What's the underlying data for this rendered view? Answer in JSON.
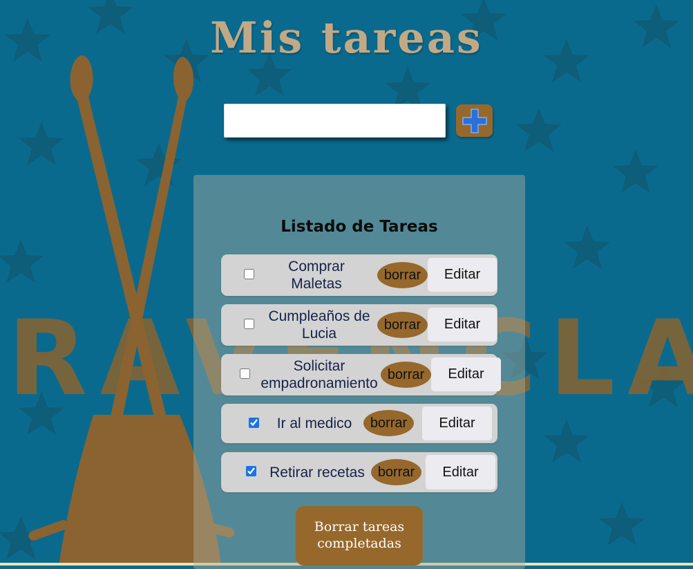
{
  "page": {
    "title": "Mis tareas"
  },
  "new_task": {
    "value": "",
    "placeholder": ""
  },
  "add_button": {
    "icon": "plus-icon"
  },
  "list": {
    "title": "Listado de Tareas",
    "tasks": [
      {
        "line1": "Comprar",
        "line2": "Maletas",
        "checked": false,
        "delete_label": "borrar",
        "edit_label": "Editar"
      },
      {
        "line1": "Cumpleaños de",
        "line2": "Lucia",
        "checked": false,
        "delete_label": "borrar",
        "edit_label": "Editar"
      },
      {
        "line1": "Solicitar",
        "line2": "empadronamiento",
        "checked": false,
        "delete_label": "borrar",
        "edit_label": "Editar"
      },
      {
        "line1": "Ir al medico",
        "checked": true,
        "delete_label": "borrar",
        "edit_label": "Editar"
      },
      {
        "line1": "Retirar recetas",
        "checked": true,
        "delete_label": "borrar",
        "edit_label": "Editar"
      }
    ]
  },
  "clear_button": {
    "line1": "Borrar tareas",
    "line2": "completadas"
  },
  "background": {
    "banner_text": "RAVENCLAW"
  },
  "colors": {
    "background": "#0a6a8e",
    "accent_brown": "#96682c",
    "title": "#c2a986",
    "panel": "#acafa0",
    "task_row": "#d3d3d3",
    "edit_button": "#ececf0",
    "plus_icon": "#2b6fd8"
  }
}
